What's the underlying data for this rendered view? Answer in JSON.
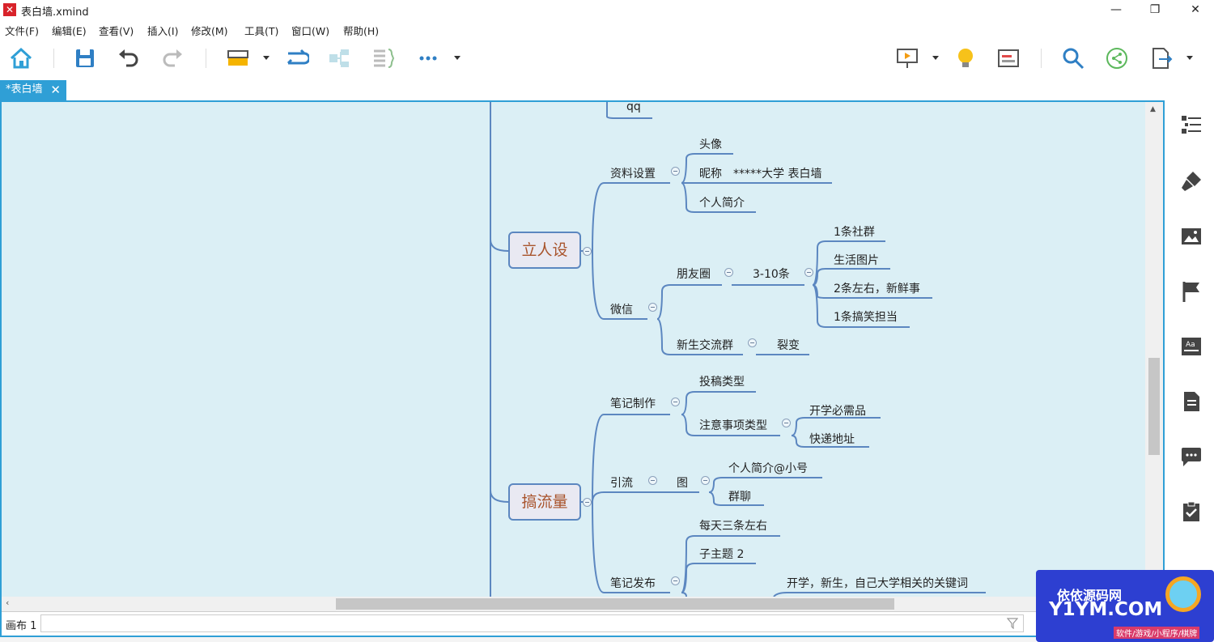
{
  "window": {
    "title": "表白墙.xmind",
    "minimize": "—",
    "maximize": "❐",
    "close": "✕"
  },
  "menu": [
    "文件(F)",
    "编辑(E)",
    "查看(V)",
    "插入(I)",
    "修改(M)",
    "工具(T)",
    "窗口(W)",
    "帮助(H)"
  ],
  "tab": {
    "label": "*表白墙",
    "close": "✕"
  },
  "sheet": {
    "label": "画布 1"
  },
  "mindmap": {
    "root1": "立人设",
    "root2": "搞流量",
    "qq": "qq",
    "zlsz": "资料设置",
    "touxiang": "头像",
    "nicheng": "昵称",
    "daxue": "*****大学 表白墙",
    "grjj": "个人简介",
    "weixin": "微信",
    "pyq": "朋友圈",
    "pyq_count": "3-10条",
    "sq": "1条社群",
    "shtp": "生活图片",
    "xxs": "2条左右，新鲜事",
    "gx": "1条搞笑担当",
    "xsjlq": "新生交流群",
    "liebian": "裂变",
    "bjzz": "笔记制作",
    "tglx": "投稿类型",
    "zysx": "注意事项类型",
    "kxbxp": "开学必需品",
    "kddz": "快递地址",
    "yinliu": "引流",
    "tu": "图",
    "grjj_xh": "个人简介@小号",
    "qunliao": "群聊",
    "bjfb": "笔记发布",
    "mtst": "每天三条左右",
    "zzt2": "子主题 2",
    "gjc": "开学，新生，自己大学相关的关键词"
  },
  "watermark": {
    "title": "依依源码网",
    "site": "Y1YM.COM",
    "sub": "软件/游戏/小程序/棋牌"
  },
  "colors": {
    "accent": "#2f9fd6",
    "canvas": "#dbeff5",
    "branch": "#5c87c0",
    "root_text": "#a8532b"
  }
}
